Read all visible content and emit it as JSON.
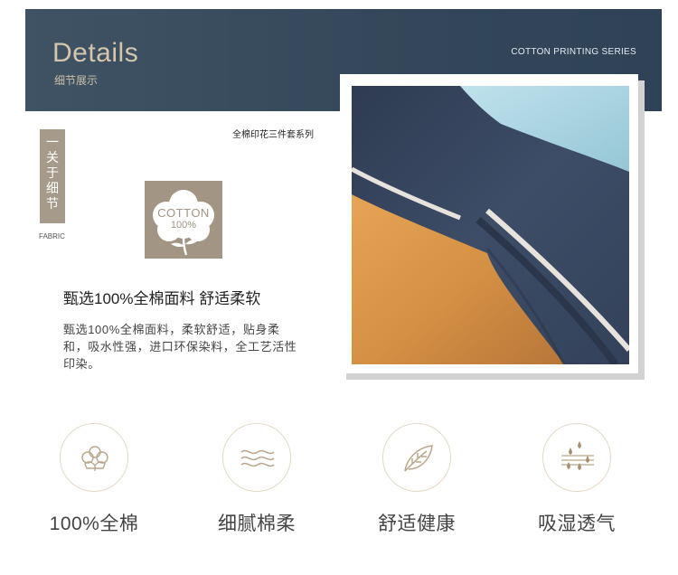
{
  "banner": {
    "title": "Details",
    "subtitle": "细节展示",
    "series": "COTTON PRINTING SERIES"
  },
  "series_cn": "全棉印花三件套系列",
  "side_label": {
    "chars": [
      "一",
      "关",
      "于",
      "细",
      "节"
    ],
    "tag": "FABRIC"
  },
  "badge": {
    "line1": "COTTON",
    "line2": "100%"
  },
  "heading": "甄选100%全棉面料 舒适柔软",
  "description": "甄选100%全棉面料，柔软舒适，贴身柔和，吸水性强，进口环保染料，全工艺活性印染。",
  "features": [
    {
      "icon": "cotton-flower-icon",
      "label": "100%全棉"
    },
    {
      "icon": "soft-waves-icon",
      "label": "细腻棉柔"
    },
    {
      "icon": "leaf-icon",
      "label": "舒适健康"
    },
    {
      "icon": "water-drops-icon",
      "label": "吸湿透气"
    }
  ],
  "colors": {
    "banner": "#34475a",
    "accent": "#a69a8a",
    "fabric_navy": "#3a4a62",
    "fabric_orange": "#d8964a",
    "fabric_lightblue": "#a9d6e3"
  }
}
